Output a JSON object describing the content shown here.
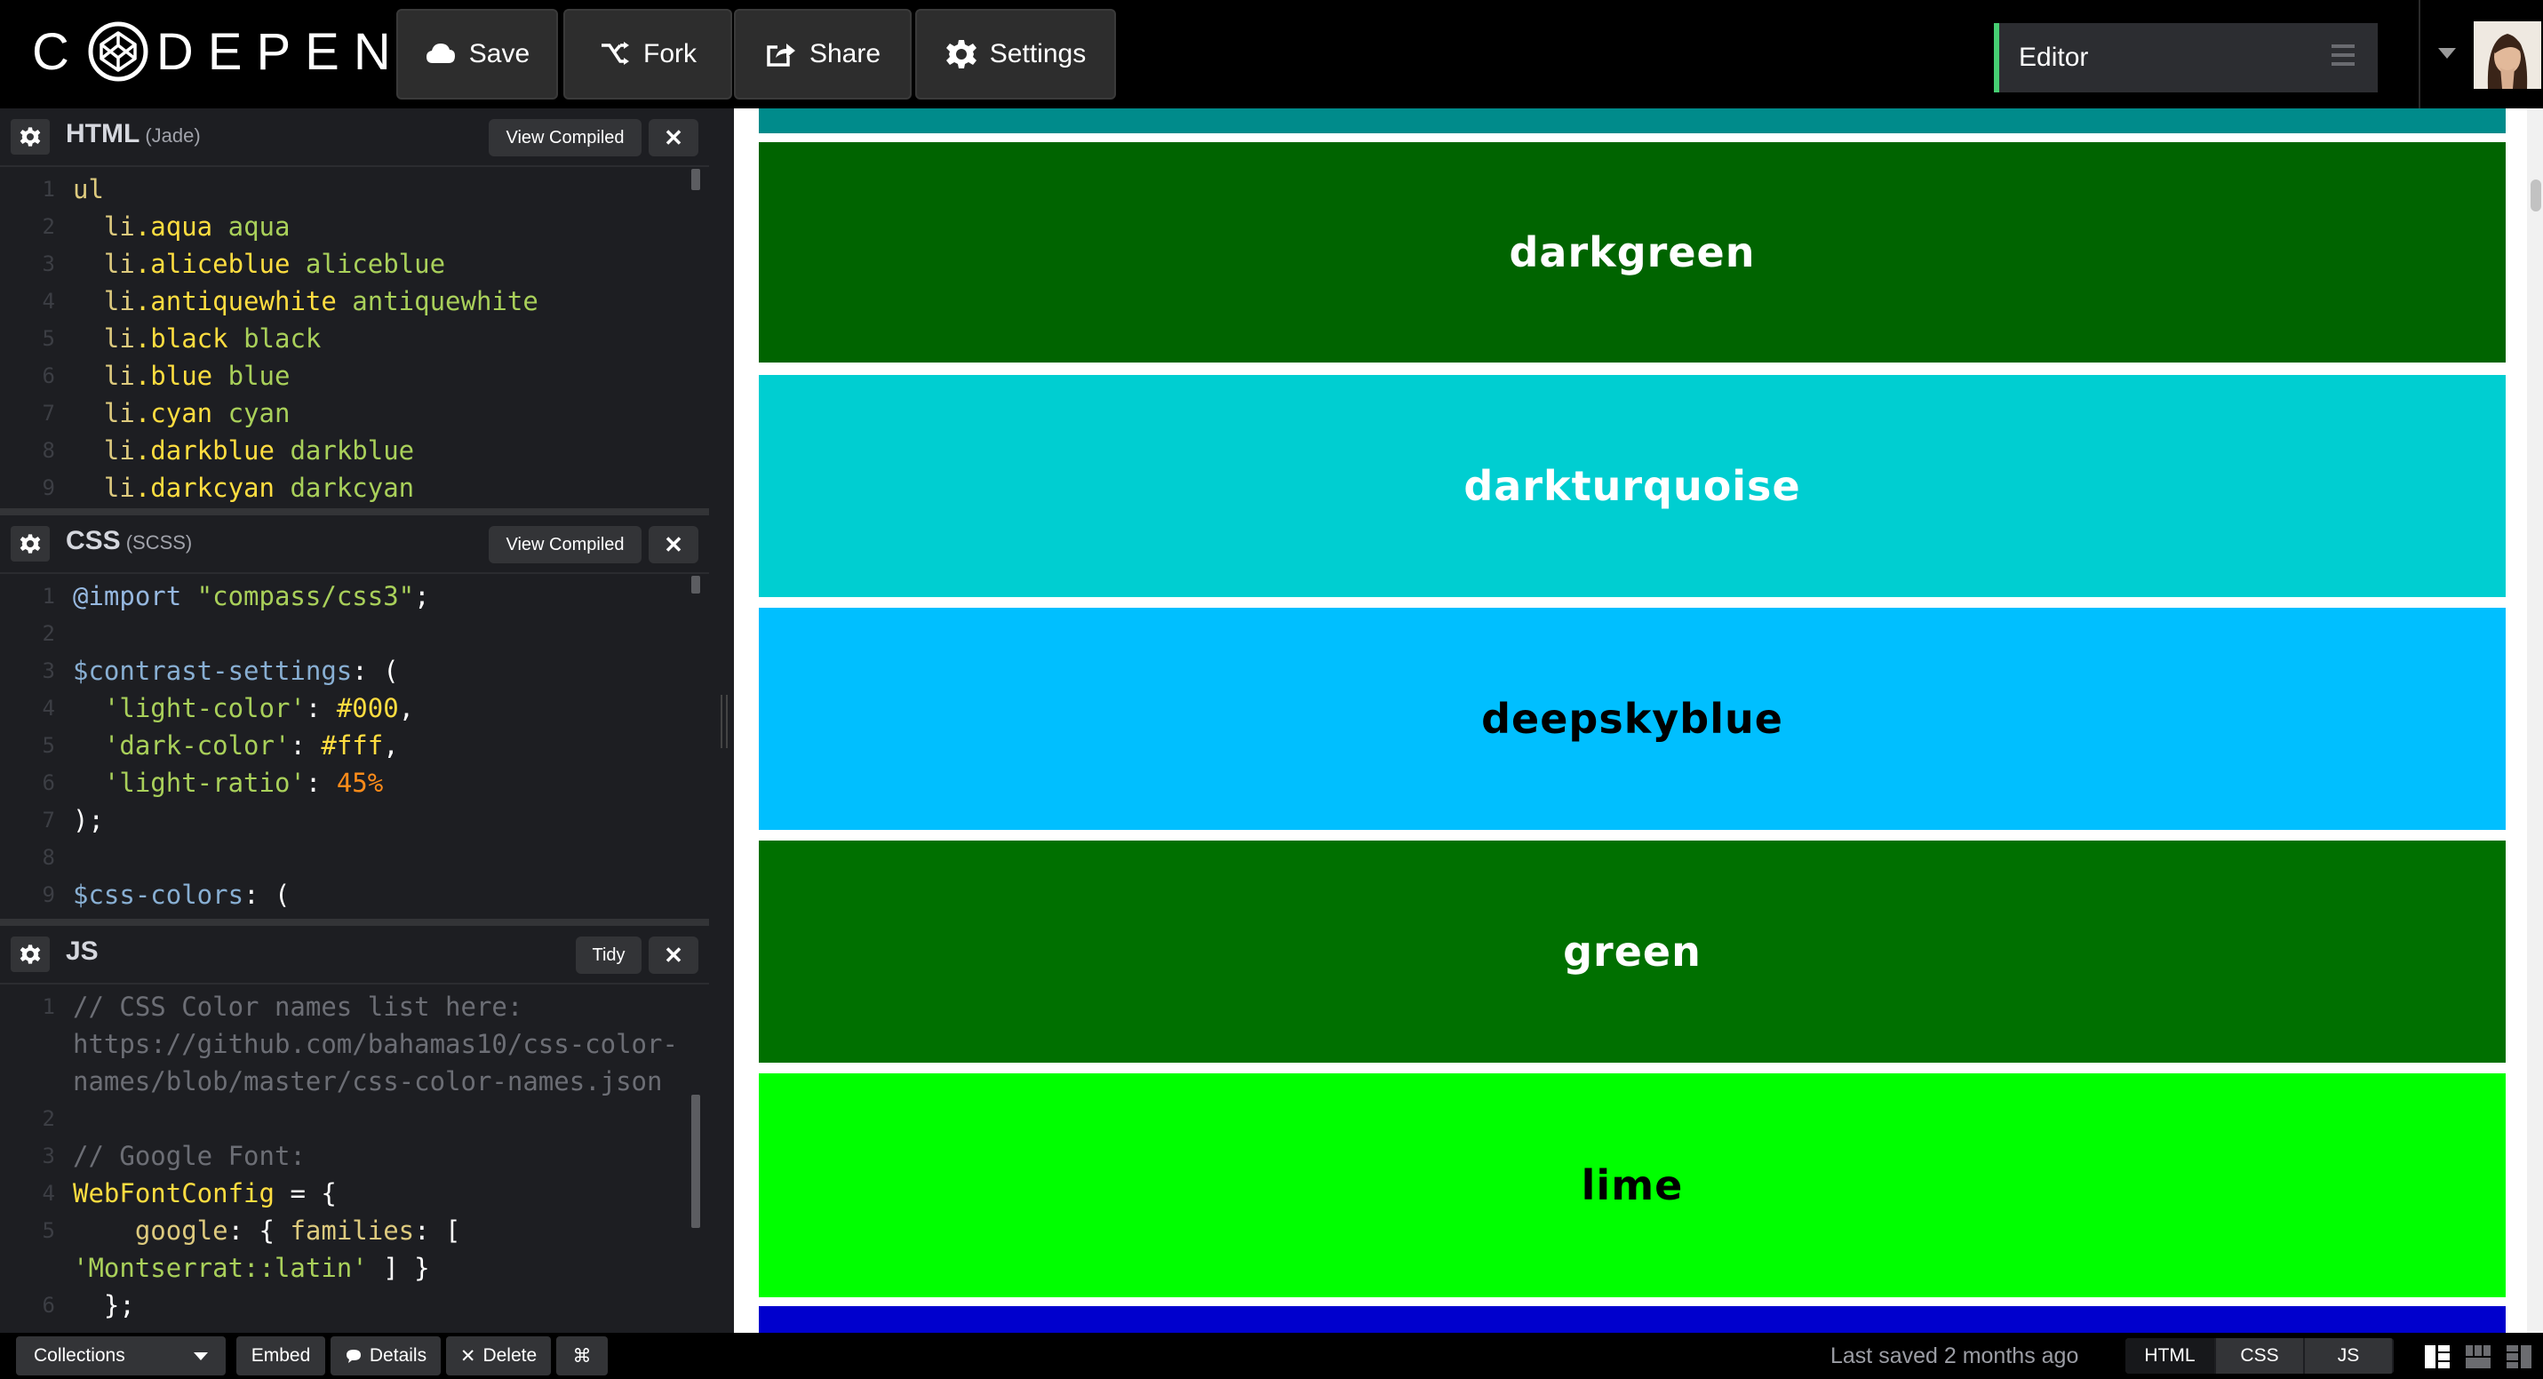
{
  "header": {
    "logo_text": "C DEPEN",
    "save_label": "Save",
    "fork_label": "Fork",
    "share_label": "Share",
    "settings_label": "Settings",
    "view_mode": "Editor"
  },
  "html_panel": {
    "title": "HTML",
    "subtitle": "(Jade)",
    "view_compiled_label": "View Compiled",
    "line_numbers": [
      "1",
      "2",
      "3",
      "4",
      "5",
      "6",
      "7",
      "8",
      "9"
    ]
  },
  "css_panel": {
    "title": "CSS",
    "subtitle": "(SCSS)",
    "view_compiled_label": "View Compiled",
    "line_numbers": [
      "1",
      "2",
      "3",
      "4",
      "5",
      "6",
      "7",
      "8",
      "9"
    ]
  },
  "js_panel": {
    "title": "JS",
    "tidy_label": "Tidy",
    "line_numbers": [
      "1",
      "",
      "",
      "2",
      "3",
      "4",
      "5",
      "",
      "6"
    ]
  },
  "code": {
    "html": {
      "l1": "ul",
      "l2a": "li",
      "l2b": ".aqua",
      "l2c": " aqua",
      "l3a": "li",
      "l3b": ".aliceblue",
      "l3c": " aliceblue",
      "l4a": "li",
      "l4b": ".antiquewhite",
      "l4c": " antiquewhite",
      "l5a": "li",
      "l5b": ".black",
      "l5c": " black",
      "l6a": "li",
      "l6b": ".blue",
      "l6c": " blue",
      "l7a": "li",
      "l7b": ".cyan",
      "l7c": " cyan",
      "l8a": "li",
      "l8b": ".darkblue",
      "l8c": " darkblue",
      "l9a": "li",
      "l9b": ".darkcyan",
      "l9c": " darkcyan"
    },
    "css": {
      "l1a": "@import",
      "l1b": " \"compass/css3\"",
      "l1c": ";",
      "l3a": "$contrast-settings",
      "l3b": ": (",
      "l4a": "'light-color'",
      "l4b": ": ",
      "l4c": "#000",
      "l4d": ",",
      "l5a": "'dark-color'",
      "l5b": ": ",
      "l5c": "#fff",
      "l5d": ",",
      "l6a": "'light-ratio'",
      "l6b": ": ",
      "l6c": "45%",
      "l7": ");",
      "l9a": "$css-colors",
      "l9b": ": ("
    },
    "js": {
      "l1": "// CSS Color names list here:",
      "l1b": "https://github.com/bahamas10/css-color-",
      "l1c": "names/blob/master/css-color-names.json",
      "l3": "// Google Font:",
      "l4a": "WebFontConfig",
      "l4b": " = {",
      "l5a": "google",
      "l5b": ": { ",
      "l5c": "families",
      "l5d": ": [",
      "l5e": "'Montserrat::latin'",
      "l5f": " ] }",
      "l6": "};"
    }
  },
  "preview": {
    "swatches": [
      {
        "name": "",
        "color": "#008b8b",
        "text_color": "#ffffff"
      },
      {
        "name": "darkgreen",
        "color": "#006400",
        "text_color": "#ffffff"
      },
      {
        "name": "darkturquoise",
        "color": "#00ced1",
        "text_color": "#ffffff"
      },
      {
        "name": "deepskyblue",
        "color": "#00bfff",
        "text_color": "#000000"
      },
      {
        "name": "green",
        "color": "#007000",
        "text_color": "#ffffff"
      },
      {
        "name": "lime",
        "color": "#00ff00",
        "text_color": "#000000"
      },
      {
        "name": "",
        "color": "#0000cd",
        "text_color": "#ffffff"
      }
    ]
  },
  "footer": {
    "collections_label": "Collections",
    "embed_label": "Embed",
    "details_label": "Details",
    "delete_label": "Delete",
    "shortcut_label": "⌘",
    "last_saved": "Last saved 2 months ago",
    "tabs": [
      "HTML",
      "CSS",
      "JS"
    ]
  }
}
